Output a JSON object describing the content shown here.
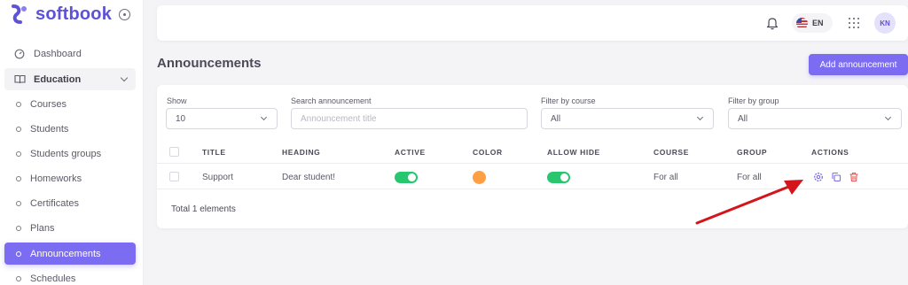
{
  "app": {
    "name": "softbook"
  },
  "sidebar": {
    "items": [
      {
        "label": "Dashboard"
      },
      {
        "label": "Education"
      },
      {
        "label": "Courses"
      },
      {
        "label": "Students"
      },
      {
        "label": "Students groups"
      },
      {
        "label": "Homeworks"
      },
      {
        "label": "Certificates"
      },
      {
        "label": "Plans"
      },
      {
        "label": "Announcements"
      },
      {
        "label": "Schedules"
      }
    ]
  },
  "topbar": {
    "language": "EN",
    "avatar_initials": "KN"
  },
  "page": {
    "title": "Announcements",
    "add_button": "Add announcement"
  },
  "filters": {
    "show": {
      "label": "Show",
      "value": "10"
    },
    "search": {
      "label": "Search announcement",
      "placeholder": "Announcement title"
    },
    "course": {
      "label": "Filter by course",
      "value": "All"
    },
    "group": {
      "label": "Filter by group",
      "value": "All"
    }
  },
  "table": {
    "columns": [
      "TITLE",
      "HEADING",
      "ACTIVE",
      "COLOR",
      "ALLOW HIDE",
      "COURSE",
      "GROUP",
      "ACTIONS"
    ],
    "rows": [
      {
        "title": "Support",
        "heading": "Dear student!",
        "active": true,
        "color": "#ff9f43",
        "allow_hide": true,
        "course": "For all",
        "group": "For all"
      }
    ],
    "total": "Total 1 elements"
  },
  "colors": {
    "accent": "#7b6cf2",
    "success": "#28c76f",
    "danger": "#ea5455",
    "annotation_arrow": "#d3161b"
  },
  "icons": [
    "gear-icon",
    "copy-icon",
    "trash-icon",
    "bell-icon",
    "apps-grid-icon",
    "dashboard-icon",
    "book-icon"
  ]
}
